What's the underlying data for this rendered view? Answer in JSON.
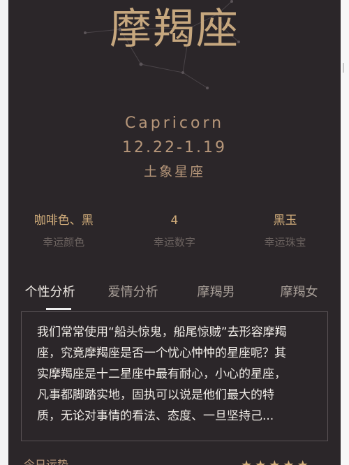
{
  "zodiac": {
    "name_cn": "摩羯座",
    "name_en": "Capricorn",
    "date_range": "12.22-1.19",
    "element": "土象星座"
  },
  "stats": [
    {
      "value": "咖啡色、黑",
      "label": "幸运颜色"
    },
    {
      "value": "4",
      "label": "幸运数字"
    },
    {
      "value": "黑玉",
      "label": "幸运珠宝"
    }
  ],
  "tabs": [
    {
      "label": "个性分析",
      "active": true
    },
    {
      "label": "爱情分析",
      "active": false
    },
    {
      "label": "摩羯男",
      "active": false
    },
    {
      "label": "摩羯女",
      "active": false
    }
  ],
  "description": [
    "我们常常使用“船头惊鬼，船尾惊贼”去形容摩羯",
    "座，究竟摩羯座是否一个忧心忡忡的星座呢？其",
    "实摩羯座是十二星座中最有耐心，小心的星座，",
    "凡事都脚踏实地，固执可以说是他们最大的特",
    "质，无论对事情的看法、态度、一旦坚持己..."
  ],
  "bottom": {
    "label": "今日运势",
    "rating": 5
  },
  "colors": {
    "background": "#2b2629",
    "gold": "#c6a77e",
    "text": "#f1ede8"
  },
  "icons": {
    "constellation": "capricorn-constellation-icon",
    "star": "star-icon"
  }
}
